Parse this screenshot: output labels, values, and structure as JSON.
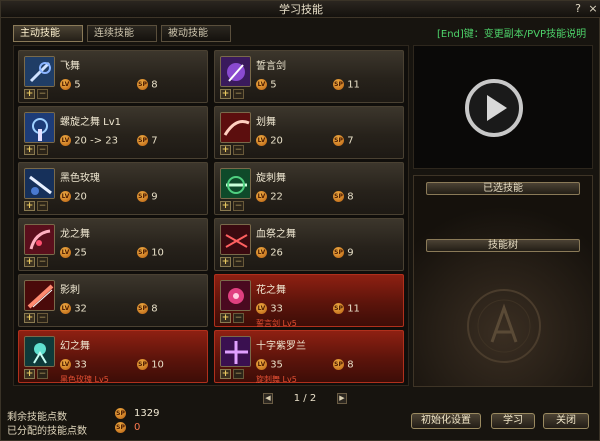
{
  "window": {
    "title": "学习技能",
    "help_label": "?",
    "close_label": "×"
  },
  "tabs": [
    {
      "label": "主动技能",
      "active": true
    },
    {
      "label": "连续技能",
      "active": false
    },
    {
      "label": "被动技能",
      "active": false
    }
  ],
  "hint_text": "[End]键：变更副本/PVP技能说明",
  "level_badge": "LV",
  "sp_badge": "SP",
  "plus_label": "+",
  "minus_label": "−",
  "skills": [
    {
      "name": "飞舞",
      "level": "5",
      "sp": "8",
      "highlighted": false,
      "requirement": "",
      "icon": "flying-dance-icon"
    },
    {
      "name": "誓言剑",
      "level": "5",
      "sp": "11",
      "highlighted": false,
      "requirement": "",
      "icon": "oath-sword-icon"
    },
    {
      "name": "螺旋之舞 Lv1",
      "level": "20 -> 23",
      "sp": "7",
      "highlighted": false,
      "requirement": "",
      "icon": "spiral-dance-icon"
    },
    {
      "name": "划舞",
      "level": "20",
      "sp": "7",
      "highlighted": false,
      "requirement": "",
      "icon": "slash-dance-icon"
    },
    {
      "name": "黑色玫瑰",
      "level": "20",
      "sp": "9",
      "highlighted": false,
      "requirement": "",
      "icon": "black-rose-icon"
    },
    {
      "name": "旋刺舞",
      "level": "22",
      "sp": "8",
      "highlighted": false,
      "requirement": "",
      "icon": "spin-thrust-dance-icon"
    },
    {
      "name": "龙之舞",
      "level": "25",
      "sp": "10",
      "highlighted": false,
      "requirement": "",
      "icon": "dragon-dance-icon"
    },
    {
      "name": "血祭之舞",
      "level": "26",
      "sp": "9",
      "highlighted": false,
      "requirement": "",
      "icon": "blood-sacrifice-dance-icon"
    },
    {
      "name": "影刺",
      "level": "32",
      "sp": "8",
      "highlighted": false,
      "requirement": "",
      "icon": "shadow-stab-icon"
    },
    {
      "name": "花之舞",
      "level": "33",
      "sp": "11",
      "highlighted": true,
      "requirement": "誓言剑 Lv5",
      "icon": "flower-dance-icon"
    },
    {
      "name": "幻之舞",
      "level": "33",
      "sp": "10",
      "highlighted": true,
      "requirement": "黑色玫瑰 Lv5",
      "icon": "phantom-dance-icon"
    },
    {
      "name": "十字紫罗兰",
      "level": "35",
      "sp": "8",
      "highlighted": true,
      "requirement": "旋刺舞 Lv5",
      "icon": "cross-violet-icon"
    }
  ],
  "side_panel": {
    "selected_label": "已选技能",
    "tree_label": "技能树"
  },
  "pager": {
    "text": "1 / 2",
    "prev": "◀",
    "next": "▶"
  },
  "footer": {
    "remaining_label": "剩余技能点数",
    "remaining_value": "1329",
    "allocated_label": "已分配的技能点数",
    "allocated_value": "0"
  },
  "buttons": {
    "reset": "初始化设置",
    "learn": "学习",
    "close": "关闭"
  },
  "colors": {
    "hint_green": "#4ed36a",
    "badge_orange": "#e09028",
    "highlight_red": "#8e2012"
  }
}
